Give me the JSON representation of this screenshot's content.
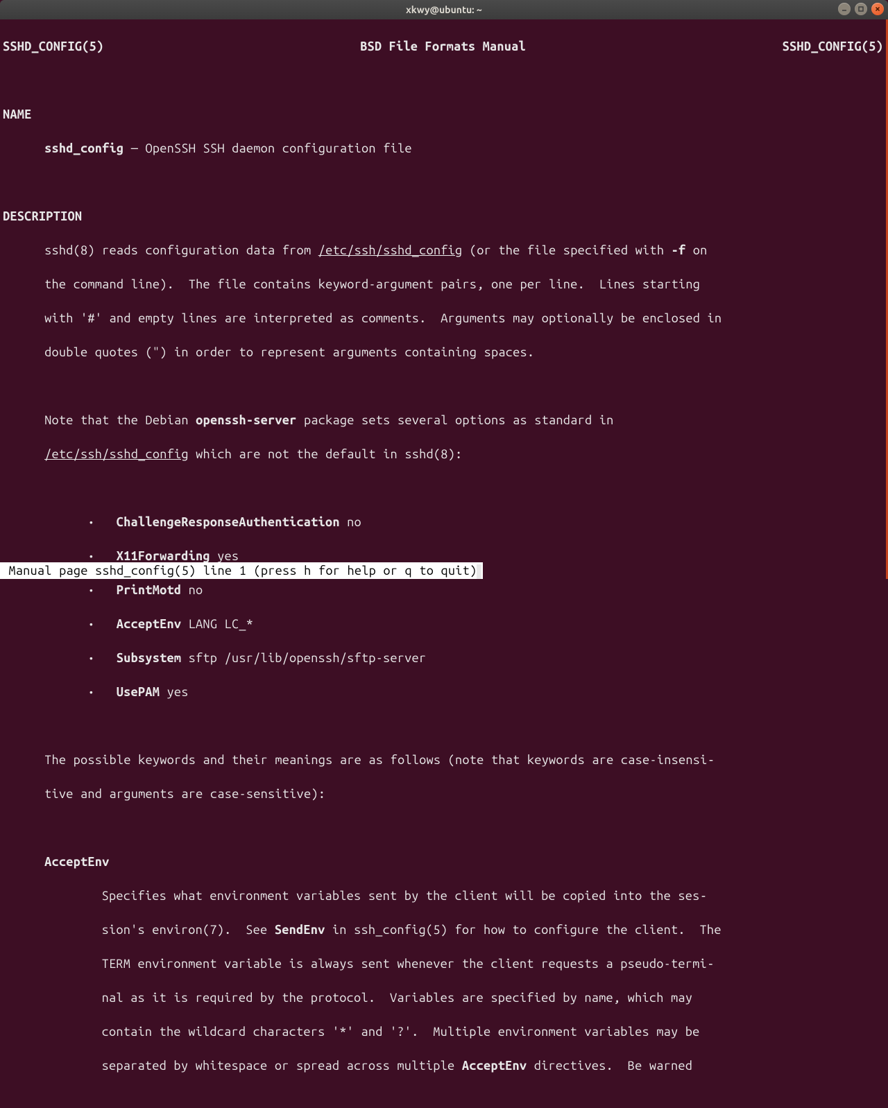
{
  "window": {
    "title": "xkwy@ubuntu: ~"
  },
  "header": {
    "left": "SSHD_CONFIG(5)",
    "center": "BSD File Formats Manual",
    "right": "SSHD_CONFIG(5)"
  },
  "sections": {
    "name_heading": "NAME",
    "name_cmd": "sshd_config",
    "name_sep": " — ",
    "name_desc": "OpenSSH SSH daemon configuration file",
    "desc_heading": "DESCRIPTION",
    "desc_p1_pre": "sshd(8) reads configuration data from ",
    "desc_p1_path": "/etc/ssh/sshd_config",
    "desc_p1_mid": " (or the file specified with ",
    "desc_p1_flag": "-f",
    "desc_p1_post": " on",
    "desc_p1_l2": "the command line).  The file contains keyword-argument pairs, one per line.  Lines starting",
    "desc_p1_l3": "with '#' and empty lines are interpreted as comments.  Arguments may optionally be enclosed in",
    "desc_p1_l4": "double quotes (\") in order to represent arguments containing spaces.",
    "desc_p2_pre": "Note that the Debian ",
    "desc_p2_pkg": "openssh-server",
    "desc_p2_post": " package sets several options as standard in",
    "desc_p2_path": "/etc/ssh/sshd_config",
    "desc_p2_rest": " which are not the default in sshd(8):",
    "bullets": [
      {
        "key": "ChallengeResponseAuthentication",
        "val": " no"
      },
      {
        "key": "X11Forwarding",
        "val": " yes"
      },
      {
        "key": "PrintMotd",
        "val": " no"
      },
      {
        "key": "AcceptEnv",
        "val": " LANG LC_*"
      },
      {
        "key": "Subsystem",
        "val": " sftp /usr/lib/openssh/sftp-server"
      },
      {
        "key": "UsePAM",
        "val": " yes"
      }
    ],
    "bullet_prefix": "·   ",
    "desc_p3_l1": "The possible keywords and their meanings are as follows (note that keywords are case-insensi‐",
    "desc_p3_l2": "tive and arguments are case-sensitive):",
    "opt1_name": "AcceptEnv",
    "opt1_l1": "Specifies what environment variables sent by the client will be copied into the ses‐",
    "opt1_l2a": "sion's environ(7).  See ",
    "opt1_l2b": "SendEnv",
    "opt1_l2c": " in ssh_config(5) for how to configure the client.  The",
    "opt1_l3": "TERM environment variable is always sent whenever the client requests a pseudo-termi‐",
    "opt1_l4": "nal as it is required by the protocol.  Variables are specified by name, which may",
    "opt1_l5": "contain the wildcard characters '*' and '?'.  Multiple environment variables may be",
    "opt1_l6a": "separated by whitespace or spread across multiple ",
    "opt1_l6b": "AcceptEnv",
    "opt1_l6c": " directives.  Be warned"
  },
  "status": " Manual page sshd_config(5) line 1 (press h for help or q to quit)"
}
